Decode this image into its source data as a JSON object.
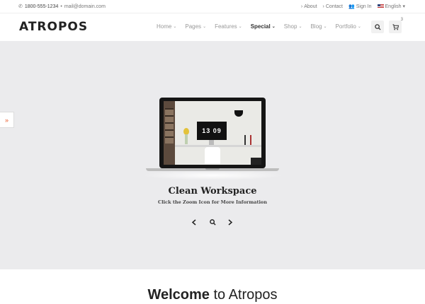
{
  "topbar": {
    "phone": "1800-555-1234",
    "separator": "•",
    "email": "mail@domain.com",
    "links": [
      {
        "label": "About",
        "icon": "chevron-right-icon"
      },
      {
        "label": "Contact",
        "icon": "chevron-right-icon"
      },
      {
        "label": "Sign In",
        "icon": "users-icon"
      }
    ],
    "language": "English"
  },
  "header": {
    "logo": "ATROPOS",
    "nav": [
      {
        "label": "Home"
      },
      {
        "label": "Pages"
      },
      {
        "label": "Features"
      },
      {
        "label": "Special"
      },
      {
        "label": "Shop"
      },
      {
        "label": "Blog"
      },
      {
        "label": "Portfolio"
      }
    ],
    "cart_count": "3"
  },
  "hero": {
    "screen_clock": "13 09",
    "title": "Clean Workspace",
    "subtitle": "Click the Zoom Icon for More Information",
    "side_tab_icon": "»"
  },
  "welcome": {
    "bold": "Welcome",
    "rest": " to Atropos"
  },
  "colors": {
    "accent": "#e85b2d",
    "hero_bg": "#ebebed"
  }
}
